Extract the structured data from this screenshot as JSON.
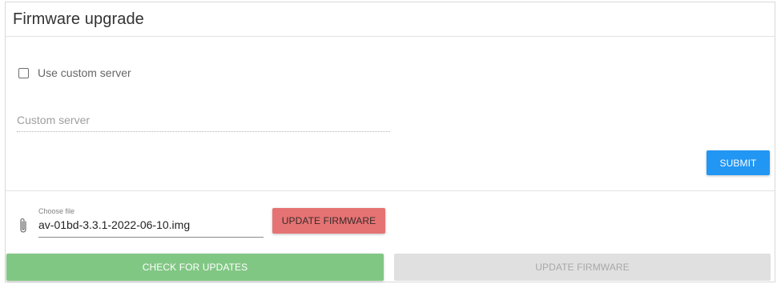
{
  "panel": {
    "title": "Firmware upgrade"
  },
  "custom_server": {
    "checkbox_label": "Use custom server",
    "checked": false,
    "input_placeholder": "Custom server",
    "input_value": "",
    "submit_label": "SUBMIT"
  },
  "file_upload": {
    "caption": "Choose file",
    "file_name": "av-01bd-3.3.1-2022-06-10.img",
    "icon": "paperclip-icon",
    "update_label": "UPDATE FIRMWARE"
  },
  "actions": {
    "check_label": "CHECK FOR UPDATES",
    "update_label": "UPDATE FIRMWARE",
    "update_disabled": true
  },
  "colors": {
    "submit": "#2196f3",
    "update_firmware_red": "#e57373",
    "check_green": "#81c784",
    "disabled_grey": "#e0e0e0"
  }
}
